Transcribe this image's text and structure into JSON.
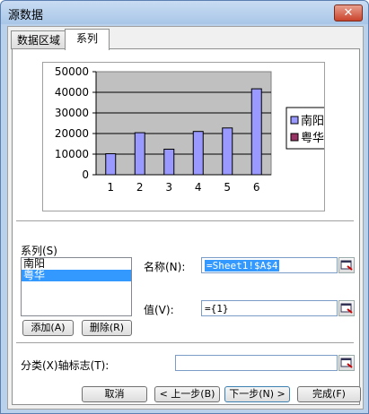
{
  "window": {
    "title": "源数据",
    "close_glyph": "✕"
  },
  "tabs": [
    {
      "label": "数据区域"
    },
    {
      "label": "系列"
    }
  ],
  "chart_data": {
    "type": "bar",
    "categories": [
      "1",
      "2",
      "3",
      "4",
      "5",
      "6"
    ],
    "series": [
      {
        "name": "南阳",
        "values": [
          10200,
          20400,
          12400,
          21000,
          22700,
          41700
        ],
        "color": "#9999ff"
      },
      {
        "name": "粤华",
        "values": [],
        "color": "#993366"
      }
    ],
    "yticks": [
      "0",
      "10000",
      "20000",
      "30000",
      "40000",
      "50000"
    ],
    "ylim": [
      0,
      50000
    ],
    "plot_background": "#c0c0c0",
    "grid": true,
    "legend_position": "right"
  },
  "series_section": {
    "label": "系列(S)",
    "items": [
      "南阳",
      "粤华"
    ],
    "selected_index": 1
  },
  "name_field": {
    "label": "名称(N):",
    "value": "=Sheet1!$A$4"
  },
  "value_field": {
    "label": "值(V):",
    "value": "={1}"
  },
  "buttons": {
    "add": "添加(A)",
    "remove": "删除(R)",
    "cancel": "取消",
    "back": "< 上一步(B)",
    "next": "下一步(N) >",
    "finish": "完成(F)"
  },
  "category_axis": {
    "label": "分类(X)轴标志(T):",
    "value": ""
  }
}
